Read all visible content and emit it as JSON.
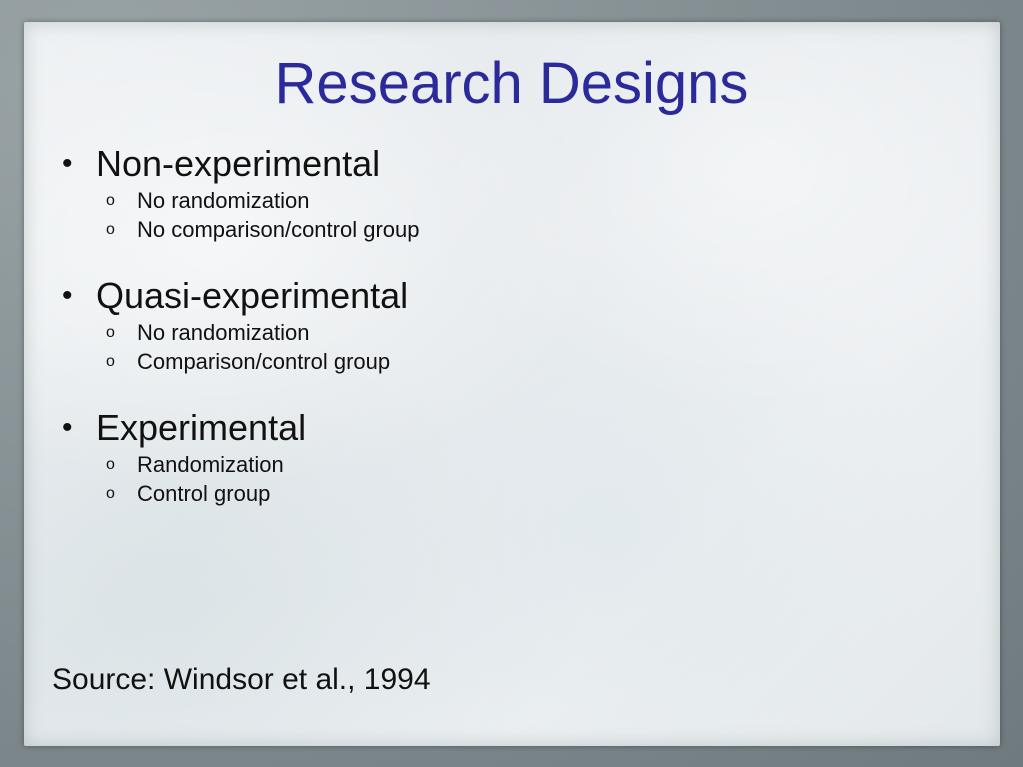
{
  "slide": {
    "title": "Research Designs",
    "groups": [
      {
        "label": "Non-experimental",
        "bullet": "•",
        "items": [
          {
            "bullet": "o",
            "text": "No randomization"
          },
          {
            "bullet": "o",
            "text": "No comparison/control group"
          }
        ]
      },
      {
        "label": "Quasi-experimental",
        "bullet": "•",
        "items": [
          {
            "bullet": "o",
            "text": "No randomization"
          },
          {
            "bullet": "o",
            "text": "Comparison/control group"
          }
        ]
      },
      {
        "label": "Experimental",
        "bullet": "•",
        "items": [
          {
            "bullet": "o",
            "text": "Randomization"
          },
          {
            "bullet": "o",
            "text": "Control group"
          }
        ]
      }
    ],
    "source": "Source: Windsor et al., 1994"
  },
  "colors": {
    "title": "#2a2a9a",
    "text": "#111111",
    "border": "#8a9598"
  }
}
